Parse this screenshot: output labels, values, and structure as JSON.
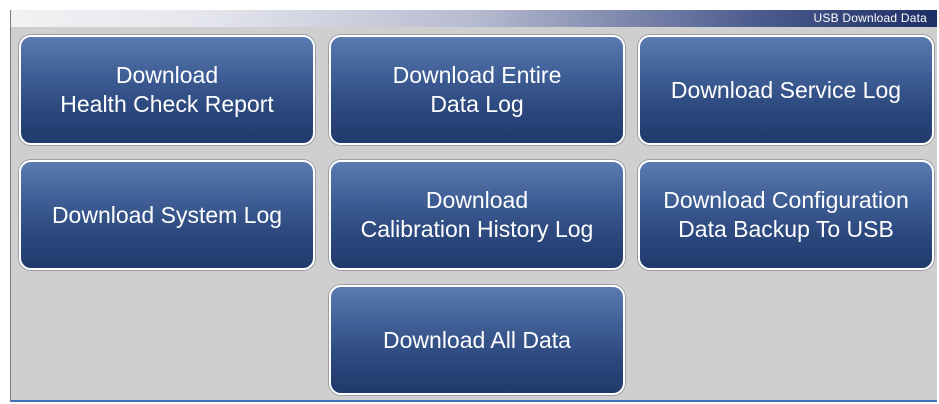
{
  "header": {
    "title": "USB Download Data"
  },
  "buttons": {
    "health_check": "Download\nHealth Check Report",
    "entire_data_log": "Download Entire\nData Log",
    "service_log": "Download Service Log",
    "system_log": "Download System Log",
    "calibration_history": "Download\nCalibration History Log",
    "config_backup": "Download Configuration\nData Backup To USB",
    "all_data": "Download All Data"
  },
  "colors": {
    "button_top": "#5a7bb0",
    "button_bottom": "#203a6c",
    "panel_background": "#cfcfcf",
    "title_bar_dark": "#1e2f66"
  }
}
